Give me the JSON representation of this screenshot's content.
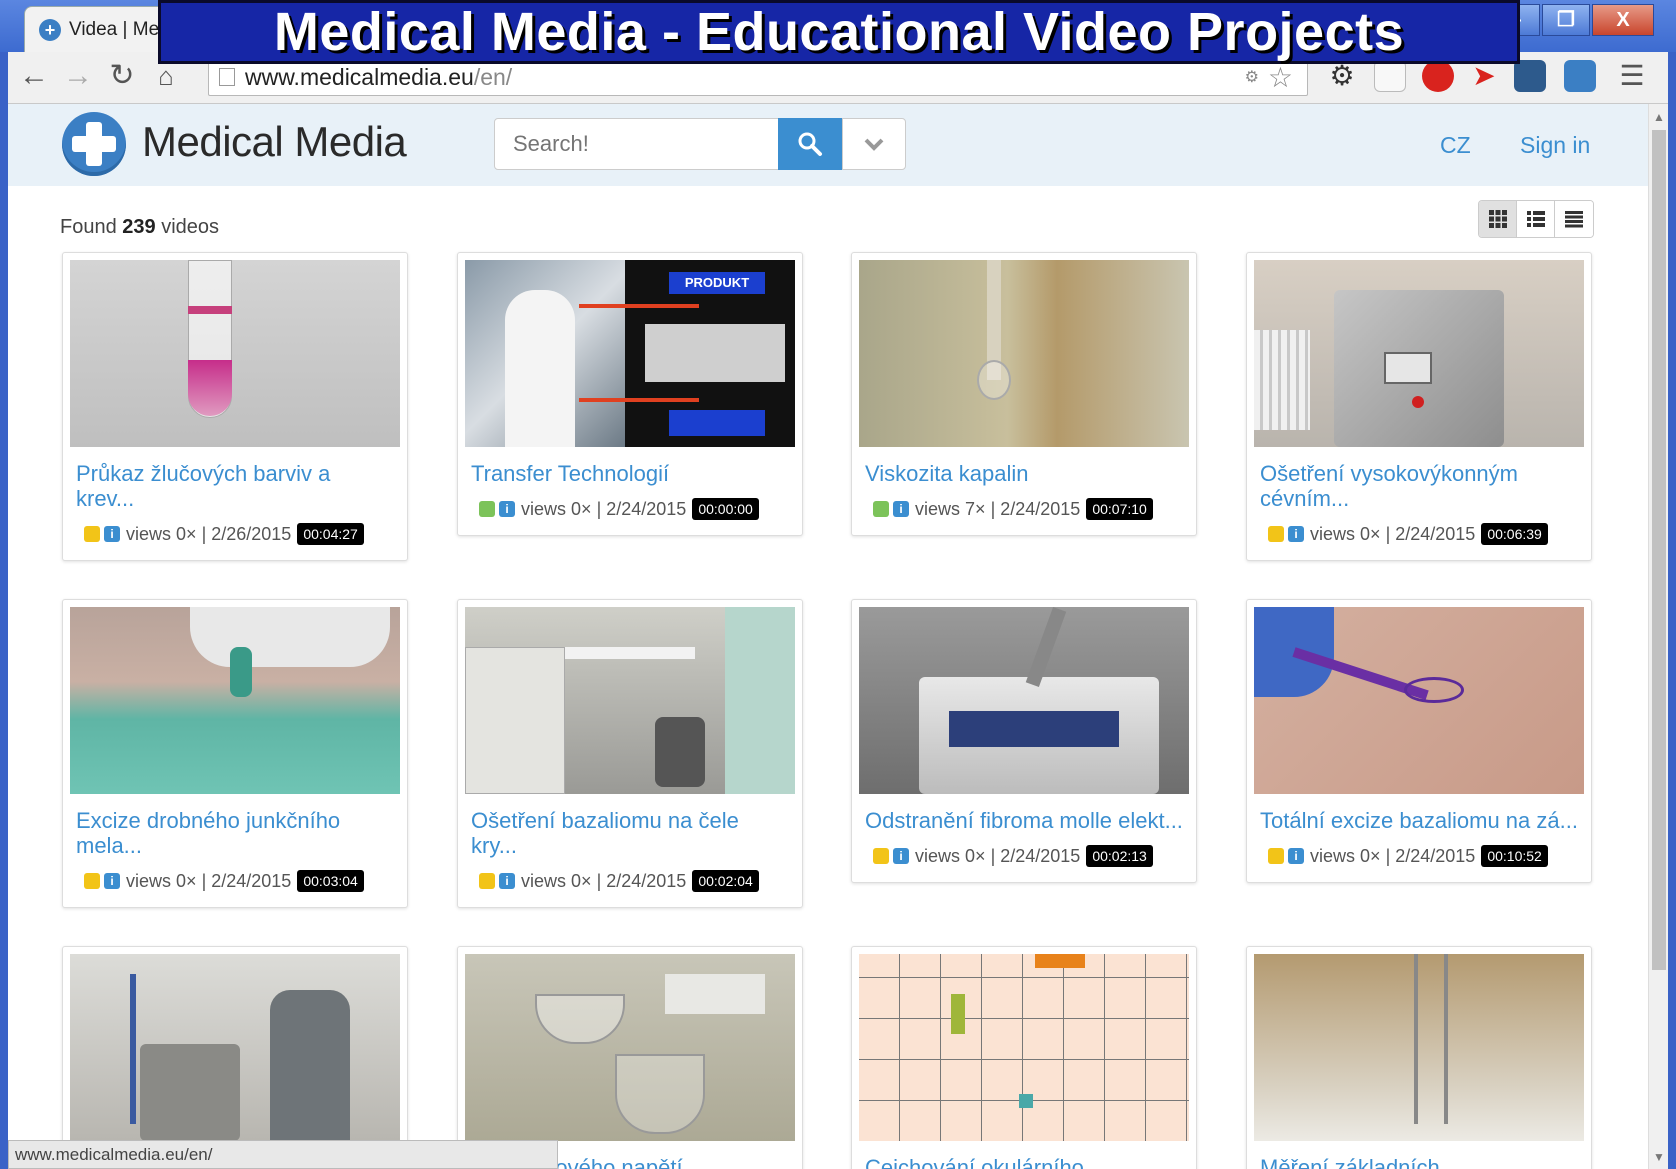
{
  "window": {
    "tab_title": "Videa | Me",
    "minimize": "–",
    "restore": "❐",
    "close": "X"
  },
  "banner": {
    "title": "Medical Media - Educational Video Projects"
  },
  "address_bar": {
    "domain": "www.medicalmedia.eu",
    "path": "/en/"
  },
  "site": {
    "name": "Medical Media",
    "search_placeholder": "Search!",
    "lang": "CZ",
    "signin": "Sign in"
  },
  "results": {
    "prefix": "Found",
    "count": "239",
    "suffix": "videos"
  },
  "videos": [
    {
      "title": "Průkaz žlučových barviv a krev...",
      "status": "yellow",
      "views": "views 0×",
      "date": "| 2/26/2015",
      "duration": "00:04:27"
    },
    {
      "title": "Transfer Technologií",
      "status": "green",
      "views": "views 0×",
      "date": "| 2/24/2015",
      "duration": "00:00:00"
    },
    {
      "title": "Viskozita kapalin",
      "status": "green",
      "views": "views 7×",
      "date": "| 2/24/2015",
      "duration": "00:07:10"
    },
    {
      "title": "Ošetření vysokovýkonným cévním...",
      "status": "yellow",
      "views": "views 0×",
      "date": "| 2/24/2015",
      "duration": "00:06:39"
    },
    {
      "title": "Excize drobného junkčního mela...",
      "status": "yellow",
      "views": "views 0×",
      "date": "| 2/24/2015",
      "duration": "00:03:04"
    },
    {
      "title": "Ošetření bazaliomu na čele kry...",
      "status": "yellow",
      "views": "views 0×",
      "date": "| 2/24/2015",
      "duration": "00:02:04"
    },
    {
      "title": "Odstranění fibroma molle elekt...",
      "status": "yellow",
      "views": "views 0×",
      "date": "| 2/24/2015",
      "duration": "00:02:13"
    },
    {
      "title": "Totální excize bazaliomu na zá...",
      "status": "yellow",
      "views": "views 0×",
      "date": "| 2/24/2015",
      "duration": "00:10:52"
    },
    {
      "title": "",
      "status": "yellow",
      "views": "",
      "date": "",
      "duration": ""
    },
    {
      "title": "...povrchového napětí",
      "status": "yellow",
      "views": "",
      "date": "",
      "duration": ""
    },
    {
      "title": "Cejchování okulárního",
      "status": "yellow",
      "views": "",
      "date": "",
      "duration": ""
    },
    {
      "title": "Měření základních",
      "status": "yellow",
      "views": "",
      "date": "",
      "duration": ""
    }
  ],
  "status_bar": {
    "url": "www.medicalmedia.eu/en/"
  },
  "colors": {
    "accent": "#3b8ed0",
    "status_yellow": "#f2c418",
    "status_green": "#7cc35a"
  }
}
